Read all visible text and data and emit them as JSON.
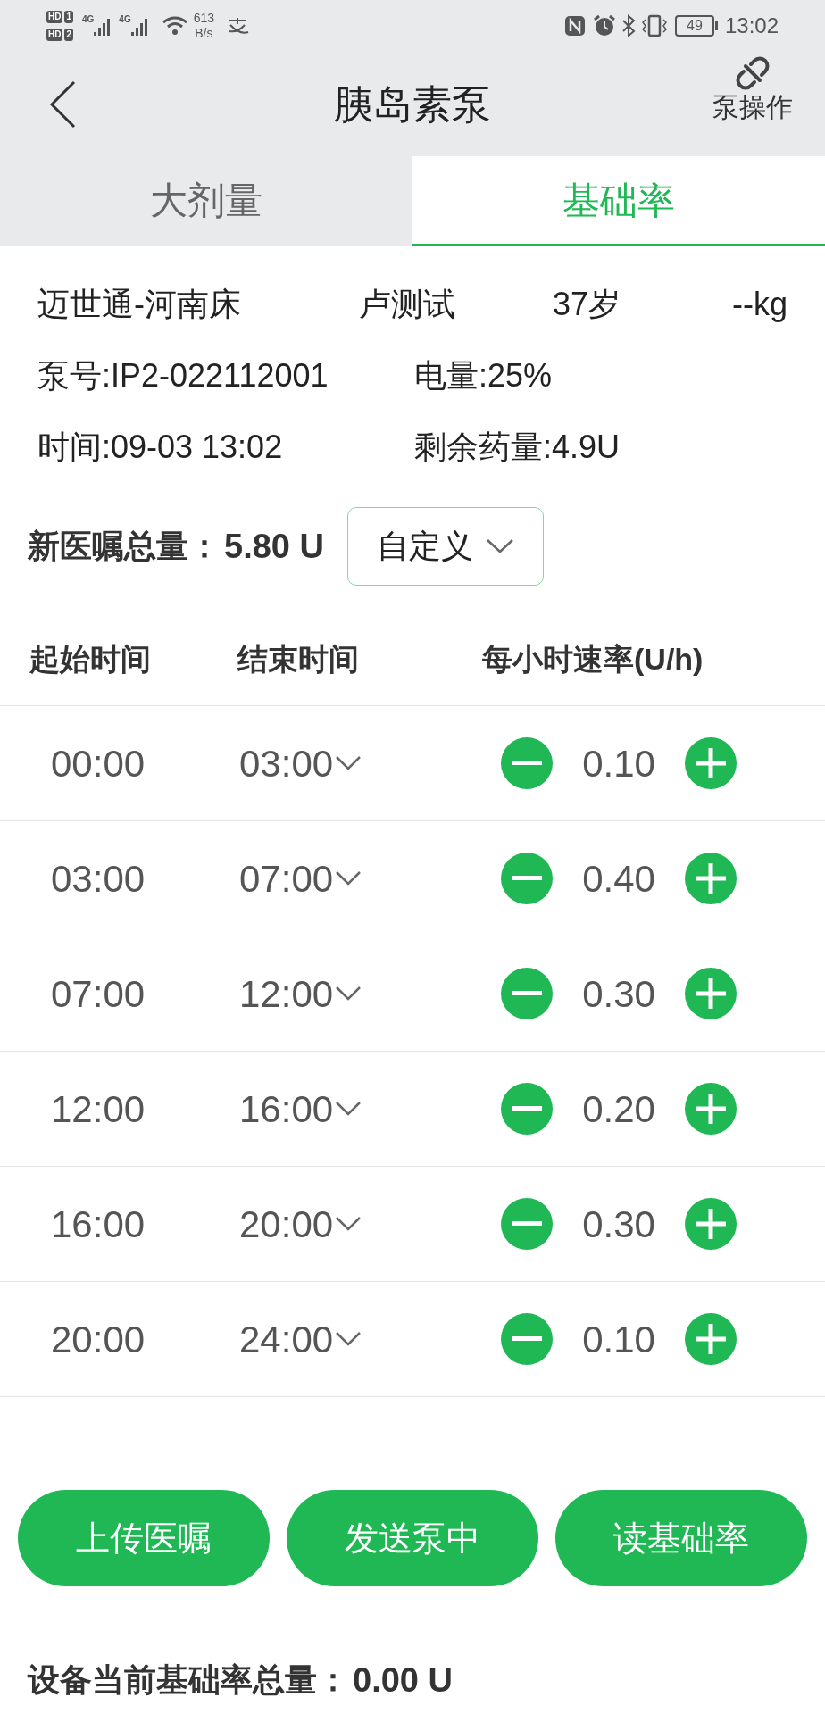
{
  "status_bar": {
    "sims": [
      {
        "hd": "HD",
        "slot": "1"
      },
      {
        "hd": "HD",
        "slot": "2"
      }
    ],
    "networks": [
      "4G",
      "4G"
    ],
    "net_speed": "613",
    "net_unit": "B/s",
    "battery": "49",
    "time": "13:02"
  },
  "header": {
    "title": "胰岛素泵",
    "action": "泵操作"
  },
  "tabs": [
    {
      "label": "大剂量",
      "selected": false
    },
    {
      "label": "基础率",
      "selected": true
    }
  ],
  "patient": {
    "hospital": "迈世通-河南床",
    "name": "卢测试",
    "age": "37岁",
    "weight": "--kg"
  },
  "pump": {
    "pump_no": "泵号:IP2-022112001",
    "power": "电量:25%",
    "time": "时间:09-03 13:02",
    "remaining": "剩余药量:4.9U"
  },
  "new_total": {
    "label": "新医嘱总量：",
    "value": "5.80 U",
    "mode": "自定义"
  },
  "table": {
    "columns": [
      "起始时间",
      "结束时间",
      "每小时速率(U/h)"
    ],
    "rows": [
      {
        "start": "00:00",
        "end": "03:00",
        "rate": "0.10"
      },
      {
        "start": "03:00",
        "end": "07:00",
        "rate": "0.40"
      },
      {
        "start": "07:00",
        "end": "12:00",
        "rate": "0.30"
      },
      {
        "start": "12:00",
        "end": "16:00",
        "rate": "0.20"
      },
      {
        "start": "16:00",
        "end": "20:00",
        "rate": "0.30"
      },
      {
        "start": "20:00",
        "end": "24:00",
        "rate": "0.10"
      }
    ]
  },
  "buttons": [
    "上传医嘱",
    "发送泵中",
    "读基础率"
  ],
  "device_total": {
    "label": "设备当前基础率总量：",
    "value": "0.00 U"
  }
}
